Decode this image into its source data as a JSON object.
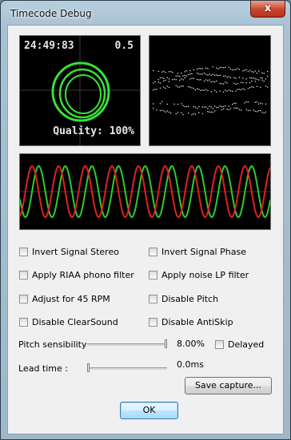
{
  "window": {
    "title": "Timecode Debug",
    "close_glyph": "x"
  },
  "scope_vinyl": {
    "timecode": "24:49:83",
    "speed": "0.5",
    "quality": "Quality: 100%"
  },
  "options": {
    "invert_stereo": "Invert Signal Stereo",
    "invert_phase": "Invert Signal Phase",
    "riaa": "Apply RIAA phono filter",
    "noise_lp": "Apply noise LP filter",
    "rpm45": "Adjust for 45 RPM",
    "disable_pitch": "Disable Pitch",
    "clearsound": "Disable ClearSound",
    "antiskip": "Disable AntiSkip"
  },
  "pitch": {
    "label": "Pitch sensibility",
    "value": "8.00%",
    "delayed": "Delayed",
    "level": 1.0
  },
  "lead": {
    "label": "Lead time :",
    "value": "0.0ms",
    "level": 0.0
  },
  "buttons": {
    "save": "Save capture...",
    "ok": "OK"
  },
  "colors": {
    "scope_bg": "#000000",
    "ring": "#38e038",
    "wave_green": "#2ecc2e",
    "wave_red": "#e02020"
  }
}
